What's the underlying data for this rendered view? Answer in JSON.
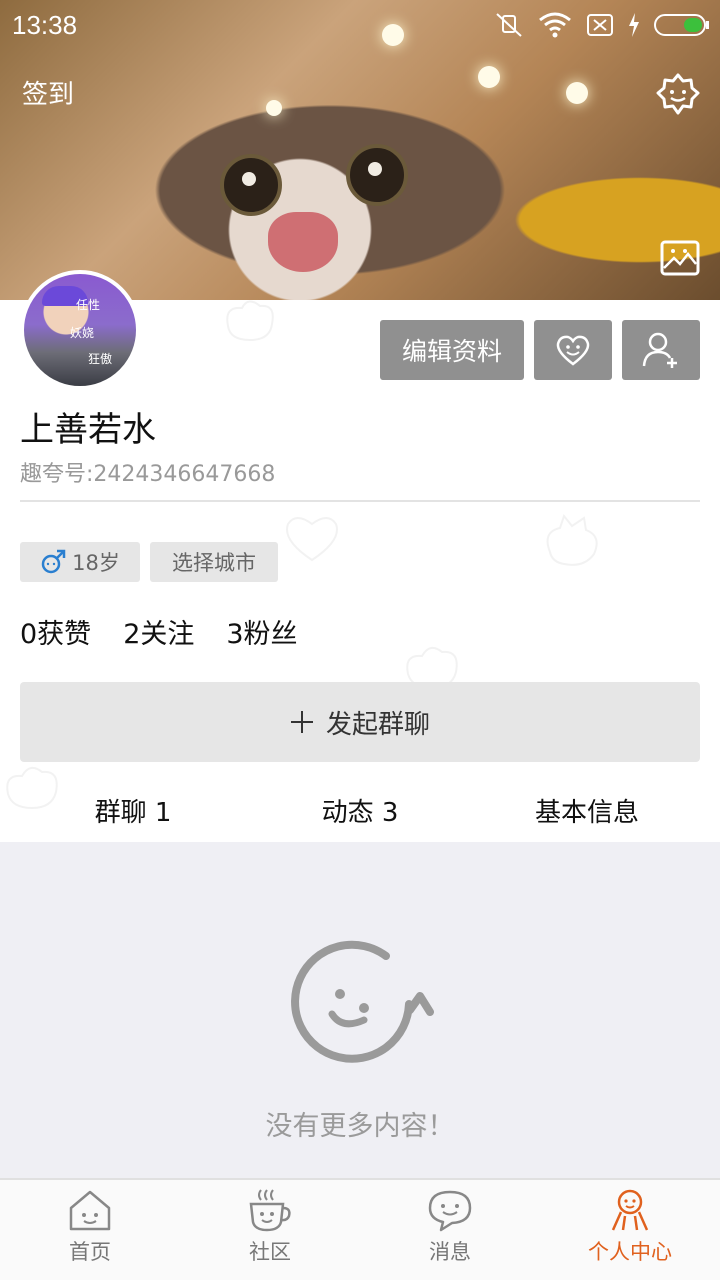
{
  "status_bar": {
    "time": "13:38",
    "icons": [
      "mute-icon",
      "wifi-icon",
      "no-sim-icon",
      "charging-icon",
      "battery-icon"
    ]
  },
  "header": {
    "checkin_label": "签到",
    "settings_icon": "gear-icon",
    "change_cover_icon": "image-icon"
  },
  "profile": {
    "avatar_tags": [
      "任性",
      "妖娆",
      "狂傲"
    ],
    "edit_label": "编辑资料",
    "like_icon": "heart-smile-icon",
    "follow_icon": "add-user-icon",
    "name": "上善若水",
    "id_text": "趣夸号:2424346647668",
    "age": "18岁",
    "gender_icon": "male-icon",
    "city_label": "选择城市",
    "stats": [
      "0获赞",
      "2关注",
      "3粉丝"
    ]
  },
  "actions": {
    "start_group_label": "发起群聊",
    "plus_icon": "plus-icon"
  },
  "tabs": [
    "群聊 1",
    "动态 3",
    "基本信息"
  ],
  "empty_state": {
    "icon": "smile-refresh-icon",
    "text": "没有更多内容！"
  },
  "bottom_nav": {
    "items": [
      {
        "label": "首页",
        "icon": "home-icon"
      },
      {
        "label": "社区",
        "icon": "coffee-cup-icon"
      },
      {
        "label": "消息",
        "icon": "chat-bubble-icon"
      },
      {
        "label": "个人中心",
        "icon": "person-icon"
      }
    ],
    "active_color": "#e0611e"
  },
  "colors": {
    "button_gray": "#909090",
    "chip_gray": "#e6e6e6",
    "content_bg": "#efeff4",
    "accent": "#e0611e"
  }
}
